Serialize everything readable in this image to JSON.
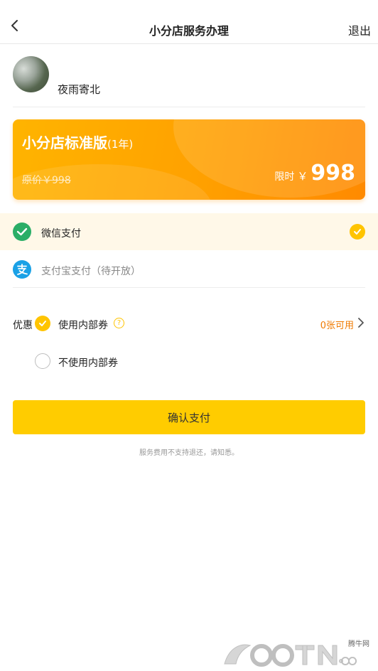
{
  "header": {
    "title": "小分店服务办理",
    "exit_label": "退出"
  },
  "profile": {
    "name": "夜雨寄北"
  },
  "plan": {
    "name": "小分店标准版",
    "duration": "(1年)",
    "original_price": "原价￥998",
    "limit_label": "限时",
    "currency": "￥",
    "price": "998"
  },
  "payment": {
    "methods": [
      {
        "label": "微信支付",
        "selected": true
      },
      {
        "label": "支付宝支付（待开放）",
        "selected": false
      }
    ]
  },
  "coupon": {
    "label": "优惠",
    "options": [
      {
        "label": "使用内部券",
        "selected": true
      },
      {
        "label": "不使用内部券",
        "selected": false
      }
    ],
    "help_symbol": "?",
    "available": "0张可用"
  },
  "confirm_label": "确认支付",
  "notice": "服务费用不支持退还，请知悉。",
  "watermark": {
    "site": "腾牛网",
    "logo_text": "QQTN.com"
  },
  "colors": {
    "accent": "#ffcc00",
    "card_gradient_start": "#ffb400",
    "card_gradient_end": "#ff8a00",
    "available_text": "#f07a00",
    "selected_row_bg": "#fff8e8",
    "wechat_green": "#2aae67",
    "alipay_blue": "#1aa1e6"
  }
}
